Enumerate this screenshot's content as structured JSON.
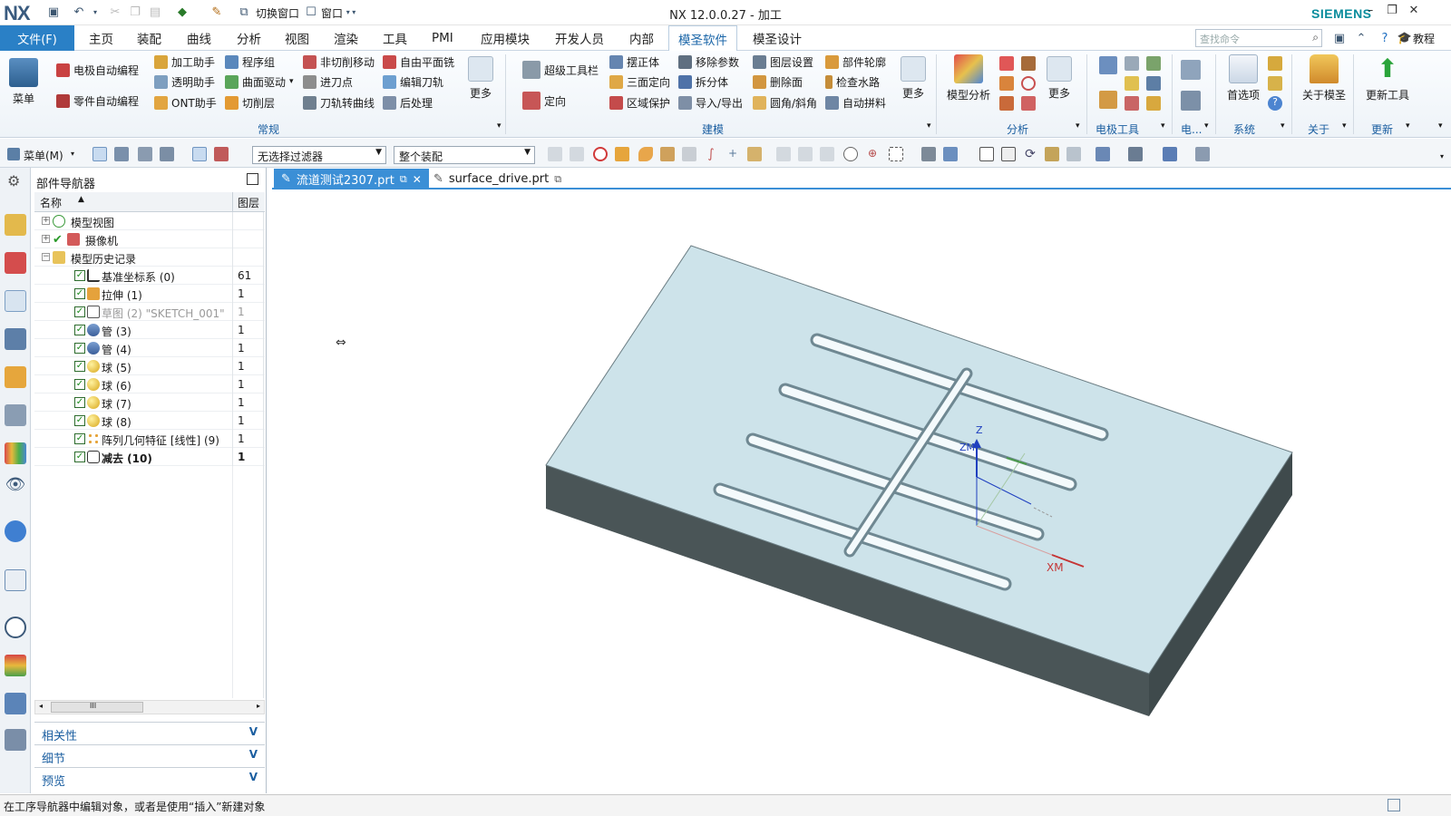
{
  "app": {
    "logo": "NX",
    "title": "NX 12.0.0.27 - 加工",
    "brand": "SIEMENS",
    "quick_access": {
      "switch_window": "切换窗口",
      "window": "窗口"
    }
  },
  "menubar": {
    "file": "文件(F)",
    "tabs": [
      "主页",
      "装配",
      "曲线",
      "分析",
      "视图",
      "渲染",
      "工具",
      "PMI",
      "应用模块",
      "开发人员",
      "内部",
      "模圣软件",
      "模圣设计"
    ],
    "active_tab": "模圣软件",
    "search_placeholder": "查找命令",
    "tutorial": "教程"
  },
  "ribbon": {
    "menu": "菜单",
    "regular": {
      "label": "常规",
      "buttons": [
        "电极自动编程",
        "零件自动编程",
        "加工助手",
        "透明助手",
        "ONT助手",
        "程序组",
        "曲面驱动",
        "切削层",
        "非切削移动",
        "进刀点",
        "刀轨转曲线",
        "自由平面铣",
        "编辑刀轨",
        "后处理"
      ],
      "more": "更多"
    },
    "modeling": {
      "label": "建模",
      "buttons": [
        "超级工具栏",
        "定向",
        "摆正体",
        "三面定向",
        "区域保护",
        "移除参数",
        "拆分体",
        "导入/导出",
        "图层设置",
        "删除面",
        "圆角/斜角",
        "部件轮廓",
        "检查水路",
        "自动拼料"
      ],
      "more": "更多"
    },
    "analysis": {
      "label": "分析",
      "model_analysis": "模型分析",
      "more": "更多"
    },
    "electrode": {
      "label": "电极工具"
    },
    "electric": {
      "label": "电..."
    },
    "system": {
      "label": "系统",
      "preferences": "首选项"
    },
    "about": {
      "label": "关于",
      "about_btn": "关于模圣"
    },
    "update": {
      "label": "更新",
      "update_btn": "更新工具"
    }
  },
  "toolbar2": {
    "menu": "菜单(M)",
    "filter": "无选择过滤器",
    "assembly": "整个装配"
  },
  "navigator": {
    "title": "部件导航器",
    "col_name": "名称",
    "col_layer": "图层",
    "top_nodes": [
      "模型视图",
      "摄像机",
      "模型历史记录"
    ],
    "features": [
      {
        "name": "基准坐标系 (0)",
        "layer": "61"
      },
      {
        "name": "拉伸 (1)",
        "layer": "1"
      },
      {
        "name": "草图 (2) \"SKETCH_001\"",
        "layer": "1"
      },
      {
        "name": "管 (3)",
        "layer": "1"
      },
      {
        "name": "管 (4)",
        "layer": "1"
      },
      {
        "name": "球 (5)",
        "layer": "1"
      },
      {
        "name": "球 (6)",
        "layer": "1"
      },
      {
        "name": "球 (7)",
        "layer": "1"
      },
      {
        "name": "球 (8)",
        "layer": "1"
      },
      {
        "name": "阵列几何特征 [线性] (9)",
        "layer": "1"
      },
      {
        "name": "减去 (10)",
        "layer": "1"
      }
    ],
    "scroll_mark": "III",
    "panels": [
      "相关性",
      "细节",
      "预览"
    ]
  },
  "doc_tabs": [
    "流道测试2307.prt",
    "surface_drive.prt"
  ],
  "viewport": {
    "axis_z": "Z",
    "axis_zm": "ZM",
    "axis_xm": "XM"
  },
  "status": "在工序导航器中编辑对象，或者是使用“插入”新建对象",
  "colors": {
    "accent": "#2a80c6",
    "block_top": "#cde3ea",
    "block_side": "#4a5557",
    "siemens": "#0a8c9c"
  }
}
